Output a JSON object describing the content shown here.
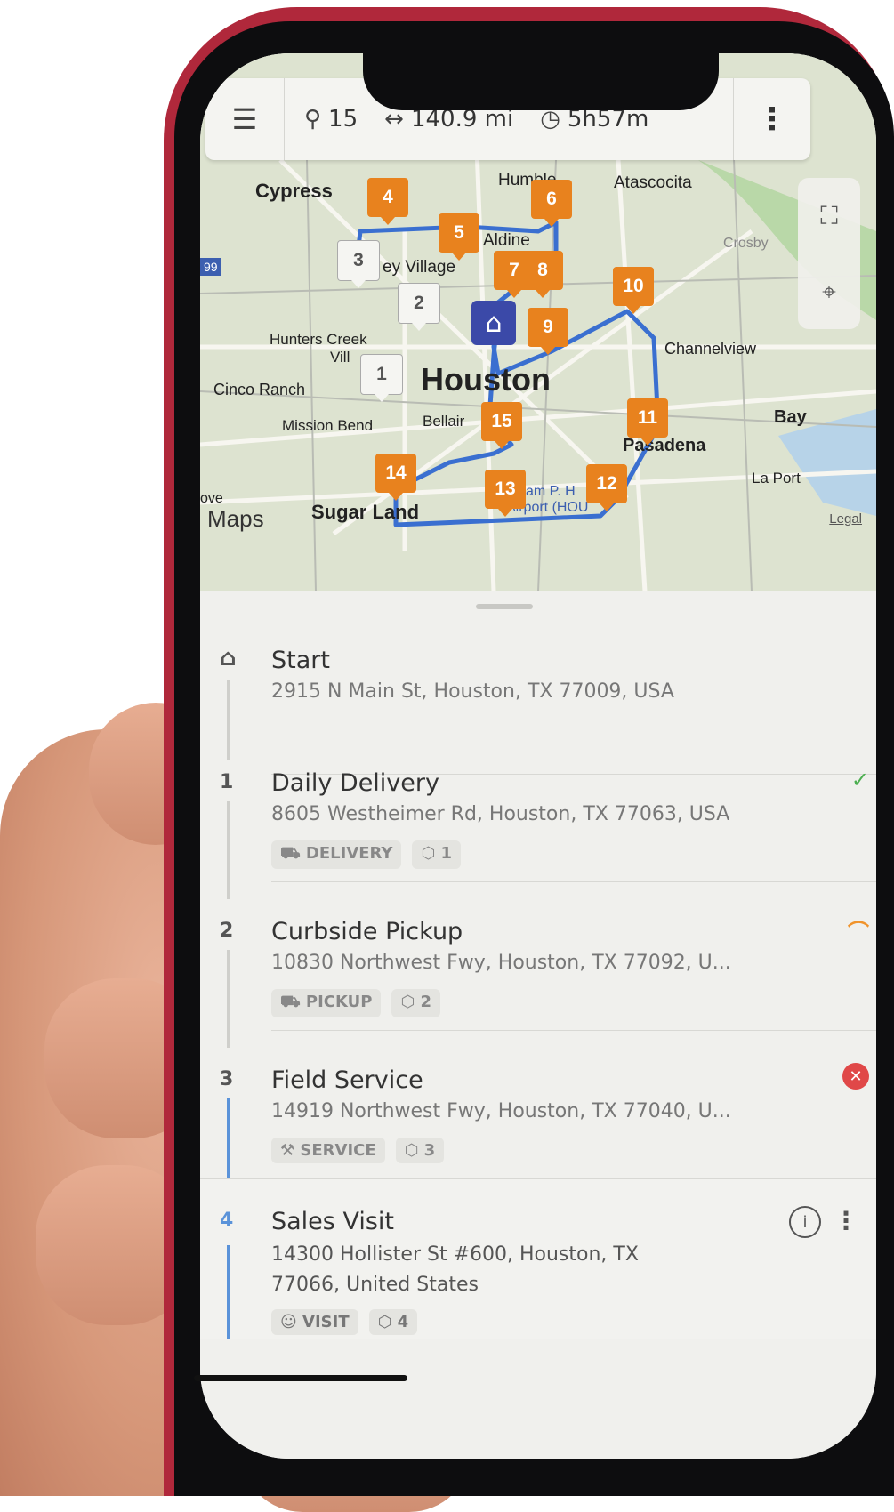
{
  "topbar": {
    "stops": "15",
    "distance": "140.9 mi",
    "duration": "5h57m",
    "icons": [
      "menu-icon",
      "pin-icon",
      "distance-icon",
      "clock-icon",
      "more-icon"
    ]
  },
  "map": {
    "places": {
      "cypress": "Cypress",
      "humble": "Humble",
      "atascocita": "Atascocita",
      "aldine": "Aldine",
      "crosby": "Crosby",
      "village": "ey Village",
      "hunters": "Hunters Creek",
      "villa": "Vill",
      "channelview": "Channelview",
      "houston": "Houston",
      "cinco": "Cinco Ranch",
      "mission": "Mission Bend",
      "bellaire": "Bellair",
      "pasadena": "Pasadena",
      "bay": "Bay",
      "laporte": "La Port",
      "sugarland": "Sugar Land",
      "airport1": "am P. H",
      "airport2": "Airport (HOU",
      "ove": "ove",
      "hwy99": "99"
    },
    "maps_logo": "Maps",
    "legal": "Legal",
    "route_color": "#3a6fd0",
    "pin_color": "#e8821e"
  },
  "stops": [
    {
      "index": "",
      "title": "Start",
      "address": "2915 N Main St, Houston, TX 77009, USA",
      "address2": "",
      "type": "",
      "count": "",
      "status": ""
    },
    {
      "index": "1",
      "title": "Daily Delivery",
      "address": "8605 Westheimer Rd, Houston, TX 77063, USA",
      "address2": "",
      "type": "DELIVERY",
      "count": "1",
      "status": "✓"
    },
    {
      "index": "2",
      "title": "Curbside Pickup",
      "address": "10830 Northwest Fwy, Houston, TX 77092, U...",
      "address2": "",
      "type": "PICKUP",
      "count": "2",
      "status": "⌒"
    },
    {
      "index": "3",
      "title": "Field Service",
      "address": "14919 Northwest Fwy, Houston, TX 77040, U...",
      "address2": "",
      "type": "SERVICE",
      "count": "3",
      "status": "✕"
    },
    {
      "index": "4",
      "title": "Sales Visit",
      "address": "14300 Hollister St #600, Houston, TX",
      "address2": "77066, United States",
      "type": "VISIT",
      "count": "4",
      "status": ""
    }
  ],
  "colors": {
    "success": "#4caf50",
    "warning": "#f0932b",
    "error": "#e04848",
    "accent": "#5b93d9"
  }
}
